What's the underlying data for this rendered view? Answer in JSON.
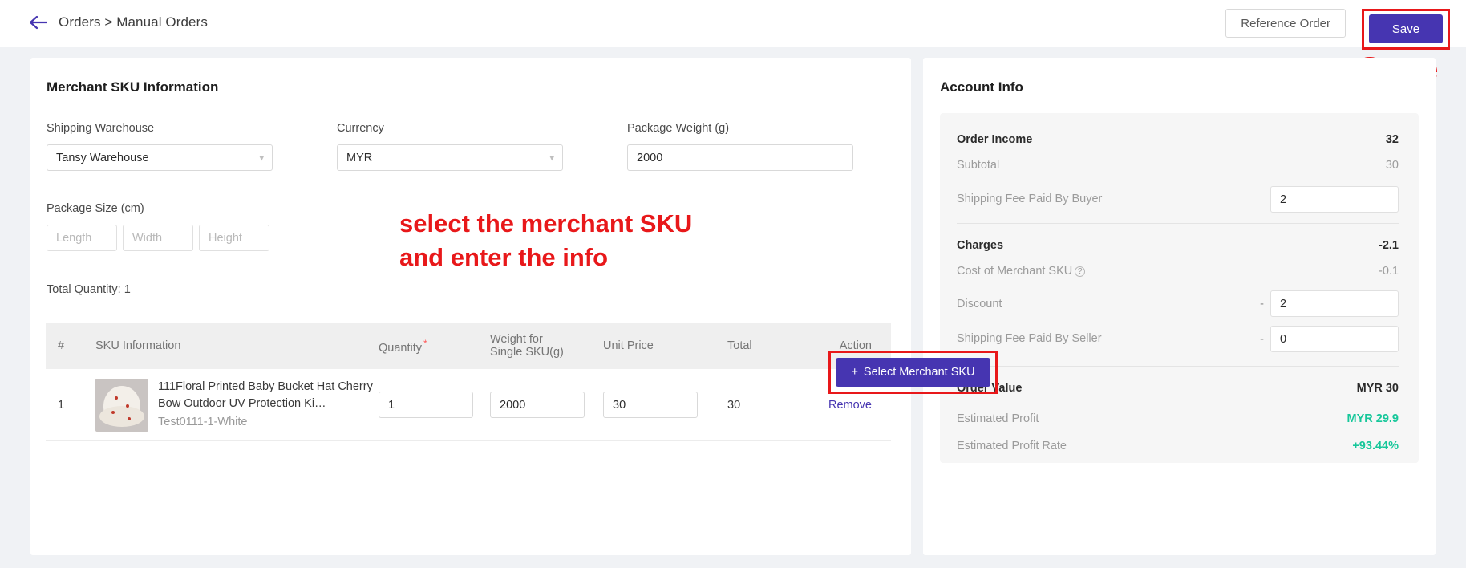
{
  "header": {
    "breadcrumb": "Orders > Manual Orders",
    "back_icon": "arrow-left-icon",
    "reference_order_label": "Reference Order",
    "save_label": "Save"
  },
  "annotations": {
    "save_callout": "Save",
    "select_sku_callout": "select the merchant SKU\nand enter the info",
    "color": "#e8181a"
  },
  "left_panel": {
    "title": "Merchant SKU Information",
    "fields": {
      "shipping_warehouse_label": "Shipping Warehouse",
      "shipping_warehouse_value": "Tansy Warehouse",
      "currency_label": "Currency",
      "currency_value": "MYR",
      "package_weight_label": "Package Weight (g)",
      "package_weight_value": "2000",
      "package_size_label": "Package Size (cm)",
      "length_placeholder": "Length",
      "width_placeholder": "Width",
      "height_placeholder": "Height"
    },
    "total_quantity": "Total Quantity: 1",
    "select_sku_button": "+ Select Merchant SKU",
    "select_sku_plus": "+",
    "select_sku_text": "Select Merchant SKU",
    "table": {
      "columns": {
        "index": "#",
        "sku_information": "SKU Information",
        "quantity": "Quantity",
        "quantity_required": "*",
        "weight_line1": "Weight for",
        "weight_line2": "Single SKU(g)",
        "unit_price": "Unit Price",
        "total": "Total",
        "action": "Action"
      },
      "rows": [
        {
          "index": "1",
          "sku_name": "111Floral Printed Baby Bucket Hat Cherry Bow Outdoor UV Protection Ki…",
          "sku_variant": "Test0111-1-White",
          "quantity": "1",
          "weight": "2000",
          "unit_price": "30",
          "total": "30",
          "action": "Remove"
        }
      ]
    }
  },
  "right_panel": {
    "title": "Account Info",
    "order_income": {
      "label": "Order Income",
      "value": "32",
      "subtotal_label": "Subtotal",
      "subtotal_value": "30",
      "shipping_fee_buyer_label": "Shipping Fee Paid By Buyer",
      "shipping_fee_buyer_value": "2"
    },
    "charges": {
      "label": "Charges",
      "value": "-2.1",
      "cost_merchant_sku_label": "Cost of Merchant SKU",
      "cost_merchant_sku_value": "-0.1",
      "discount_label": "Discount",
      "discount_sign": "-",
      "discount_value": "2",
      "shipping_fee_seller_label": "Shipping Fee Paid By Seller",
      "shipping_fee_seller_sign": "-",
      "shipping_fee_seller_value": "0"
    },
    "order_value": {
      "label": "Order Value",
      "value": "MYR 30",
      "estimated_profit_label": "Estimated Profit",
      "estimated_profit_value": "MYR 29.9",
      "estimated_profit_rate_label": "Estimated Profit Rate",
      "estimated_profit_rate_value": "+93.44%"
    }
  },
  "theme": {
    "primary": "#4635b1",
    "annotation_red": "#e8181a",
    "success_green": "#16c79a"
  }
}
